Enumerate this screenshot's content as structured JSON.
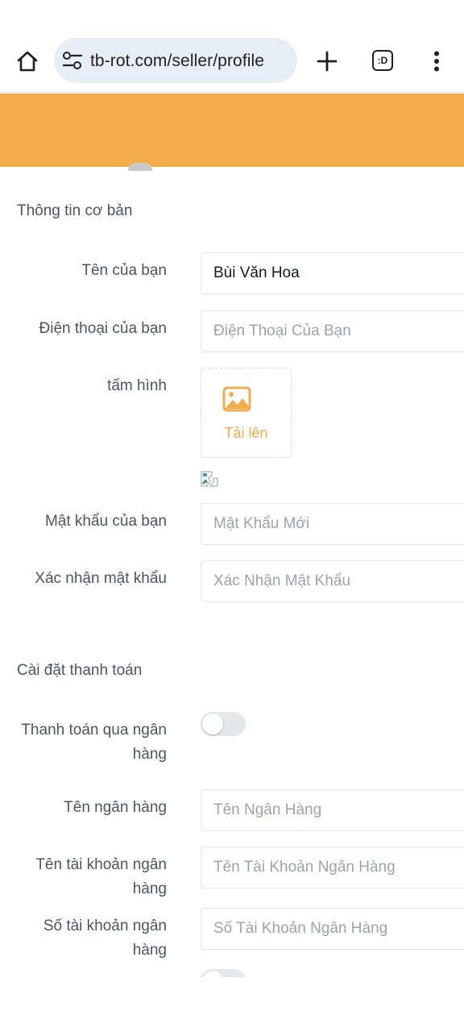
{
  "browser": {
    "url": "tb-rot.com/seller/profile",
    "tabs_label": ":D"
  },
  "colors": {
    "brand": "#f2ac4b",
    "toggle_off": "#e5e7eb"
  },
  "basic_info": {
    "section_title": "Thông tin cơ bản",
    "name_label": "Tên của bạn",
    "name_value": "Bùi Văn Hoa",
    "phone_label": "Điện thoại của bạn",
    "phone_placeholder": "Điện Thoại Của Bạn",
    "photo_label": "tấm hình",
    "upload_label": "Tải lên",
    "password_label": "Mật khẩu của bạn",
    "password_placeholder": "Mật Khẩu Mới",
    "confirm_label": "Xác nhận mật khẩu",
    "confirm_placeholder": "Xác Nhận Mật Khẩu"
  },
  "payment": {
    "section_title": "Cài đặt thanh toán",
    "bank_toggle_label_line1": "Thanh toán qua ngân",
    "bank_toggle_label_line2": "hàng",
    "bank_toggle_on": false,
    "bank_name_label": "Tên ngân hàng",
    "bank_name_placeholder": "Tên Ngân Hàng",
    "account_name_label_line1": "Tên tài khoản ngân",
    "account_name_label_line2": "hàng",
    "account_name_placeholder": "Tên Tài Khoản Ngân Hàng",
    "account_number_label_line1": "Số tài khoản ngân",
    "account_number_label_line2": "hàng",
    "account_number_placeholder": "Số Tài Khoản Ngân Hàng"
  }
}
